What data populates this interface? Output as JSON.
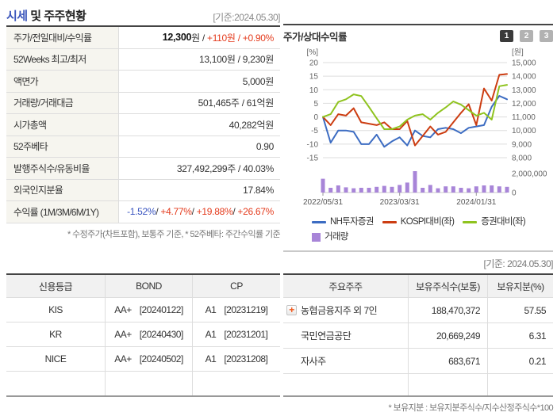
{
  "page": {
    "title_accent": "시세",
    "title_rest": " 및 주주현황",
    "title_date": "[기준:2024.05.30]",
    "chart_date": "[기준: 2024.05.30]"
  },
  "quote_table": {
    "rows": [
      {
        "label": "주가/전일대비/수익률",
        "parts": [
          {
            "t": "12,300",
            "c": "bold"
          },
          {
            "t": "원 / ",
            "c": "plain"
          },
          {
            "t": "+110원 / +0.90%",
            "c": "red"
          }
        ]
      },
      {
        "label": "52Weeks 최고/최저",
        "parts": [
          {
            "t": "13,100원 / 9,230원",
            "c": "plain"
          }
        ]
      },
      {
        "label": "액면가",
        "parts": [
          {
            "t": "5,000원",
            "c": "plain"
          }
        ]
      },
      {
        "label": "거래량/거래대금",
        "parts": [
          {
            "t": "501,465주 / 61억원",
            "c": "plain"
          }
        ]
      },
      {
        "label": "시가총액",
        "parts": [
          {
            "t": "40,282억원",
            "c": "plain"
          }
        ]
      },
      {
        "label": "52주베타",
        "parts": [
          {
            "t": "0.90",
            "c": "plain"
          }
        ]
      },
      {
        "label": "발행주식수/유동비율",
        "parts": [
          {
            "t": "327,492,299주 / 40.03%",
            "c": "plain"
          }
        ]
      },
      {
        "label": "외국인지분율",
        "parts": [
          {
            "t": "17.84%",
            "c": "plain"
          }
        ]
      },
      {
        "label": "수익률 (1M/3M/6M/1Y)",
        "parts": [
          {
            "t": "-1.52%",
            "c": "blue"
          },
          {
            "t": "/ ",
            "c": "plain"
          },
          {
            "t": "+4.77%",
            "c": "red"
          },
          {
            "t": "/ ",
            "c": "plain"
          },
          {
            "t": "+19.88%",
            "c": "red"
          },
          {
            "t": "/ ",
            "c": "plain"
          },
          {
            "t": "+26.67%",
            "c": "red"
          }
        ]
      }
    ],
    "footnote": "* 수정주가(차트포함), 보통주 기준, * 52주베타: 주간수익률 기준"
  },
  "chart_panel": {
    "title": "주가/상대수익률",
    "buttons": [
      "1",
      "2",
      "3"
    ],
    "active_button": "1"
  },
  "chart_data": {
    "type": "line+bar",
    "title": "주가/상대수익률",
    "n_points": 25,
    "x_labels": [
      "2022/05/31",
      "2023/03/31",
      "2024/01/31"
    ],
    "x_label_indices": [
      0,
      10,
      20
    ],
    "axes": {
      "left": {
        "label": "[%]",
        "ticks": [
          20,
          15,
          10,
          5,
          0,
          -5,
          -10,
          -15
        ],
        "range": [
          -15,
          20
        ]
      },
      "right": {
        "label": "[원]",
        "ticks": [
          15000,
          14000,
          13000,
          12000,
          11000,
          10000,
          9000,
          8000
        ],
        "range": [
          8000,
          15000
        ]
      },
      "volume": {
        "ticks": [
          2000000,
          0
        ],
        "range": [
          0,
          2000000
        ]
      }
    },
    "series": [
      {
        "name": "NH투자증권",
        "type": "line",
        "axis": "right",
        "color": "#3c6cc2",
        "values": [
          11000,
          9100,
          10000,
          10000,
          9900,
          9000,
          9000,
          9700,
          8800,
          9200,
          9500,
          8900,
          10000,
          9600,
          9500,
          10100,
          10200,
          10100,
          9800,
          10200,
          10300,
          10400,
          11750,
          12550,
          12300
        ]
      },
      {
        "name": "KOSPI대비(좌)",
        "type": "line",
        "axis": "left",
        "color": "#cc3d12",
        "values": [
          0,
          -3,
          1,
          0.5,
          3.2,
          -2,
          -2.5,
          -3,
          -2,
          -4.5,
          -4.5,
          -1.5,
          -10.5,
          -7,
          -3.5,
          -6.5,
          -5.5,
          -2,
          1.5,
          4.7,
          -3,
          10.5,
          6,
          15.5,
          15.8
        ]
      },
      {
        "name": "증권대비(좌)",
        "type": "line",
        "axis": "left",
        "color": "#8fc31f",
        "values": [
          0,
          1,
          5.5,
          6.5,
          8.3,
          7.7,
          3.7,
          -0.5,
          -4.5,
          -4.5,
          -3.5,
          -1,
          0.5,
          1,
          -1,
          1.5,
          3.5,
          5.7,
          4.5,
          2.5,
          0.5,
          1.5,
          -1,
          11.3,
          11.8
        ]
      },
      {
        "name": "거래량",
        "type": "bar",
        "axis": "volume",
        "color": "#a885d8",
        "values": [
          1450000,
          500000,
          750000,
          550000,
          450000,
          500000,
          500000,
          600000,
          700000,
          600000,
          800000,
          1050000,
          2250000,
          500000,
          800000,
          450000,
          650000,
          650000,
          500000,
          450000,
          650000,
          750000,
          750000,
          650000,
          600000
        ]
      }
    ],
    "legend_position": "bottom",
    "grid": true
  },
  "credit_table": {
    "headers": [
      "신용등급",
      "BOND",
      "CP"
    ],
    "rows": [
      {
        "agency": "KIS",
        "bond": "AA+",
        "bond_date": "[20240122]",
        "cp": "A1",
        "cp_date": "[20231219]"
      },
      {
        "agency": "KR",
        "bond": "AA+",
        "bond_date": "[20240430]",
        "cp": "A1",
        "cp_date": "[20231201]"
      },
      {
        "agency": "NICE",
        "bond": "AA+",
        "bond_date": "[20240502]",
        "cp": "A1",
        "cp_date": "[20231208]"
      },
      {
        "agency": "",
        "bond": "",
        "bond_date": "",
        "cp": "",
        "cp_date": ""
      }
    ]
  },
  "holders_table": {
    "headers": [
      "주요주주",
      "보유주식수(보통)",
      "보유지분(%)"
    ],
    "rows": [
      {
        "expand_icon": true,
        "name": "농협금융지주 외 7인",
        "shares": "188,470,372",
        "ratio": "57.55"
      },
      {
        "expand_icon": false,
        "name": "국민연금공단",
        "shares": "20,669,249",
        "ratio": "6.31"
      },
      {
        "expand_icon": false,
        "name": "자사주",
        "shares": "683,671",
        "ratio": "0.21"
      },
      {
        "expand_icon": false,
        "name": "",
        "shares": "",
        "ratio": ""
      }
    ],
    "footnote": "* 보유지분 : 보유지분주식수/지수산정주식수*100"
  },
  "colors": {
    "accent_blue": "#3a55bb",
    "text_red": "#e43b1d",
    "text_blue": "#3a55c0",
    "line_blue": "#3c6cc2",
    "line_red": "#cc3d12",
    "line_green": "#8fc31f",
    "volume_purple": "#a885d8",
    "label_bg": "#f6f5ef",
    "header_bg": "#f1f1f1",
    "grid": "#dddddd"
  }
}
